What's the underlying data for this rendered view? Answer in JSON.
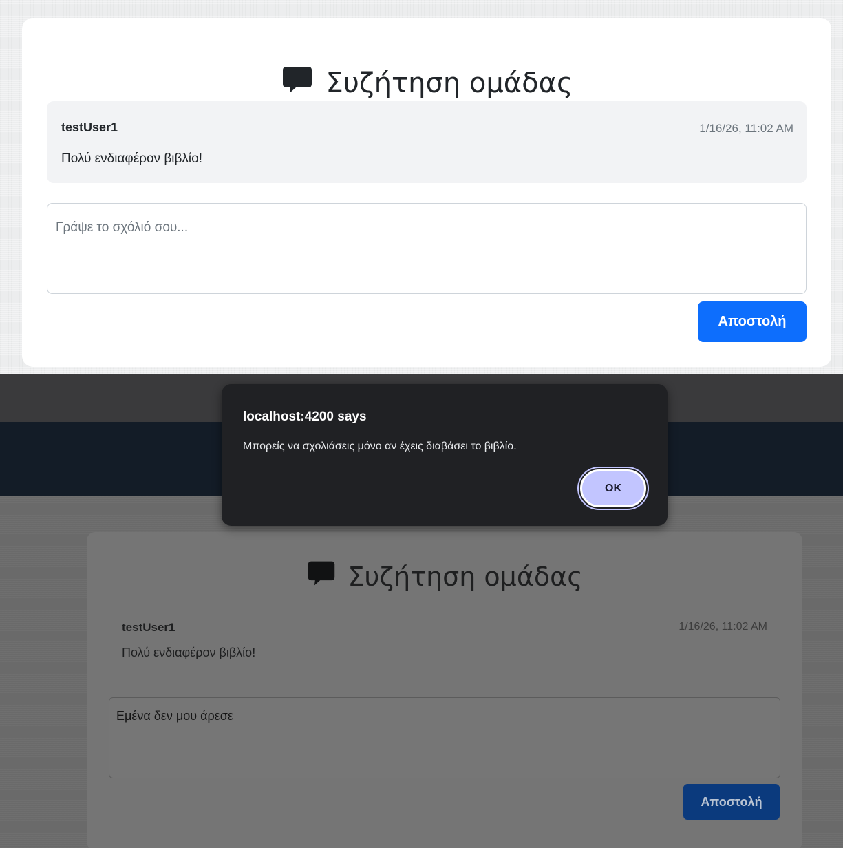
{
  "top_panel": {
    "title": "Συζήτηση ομάδας",
    "icon": "speech-bubble-icon",
    "comment": {
      "user": "testUser1",
      "time": "1/16/26, 11:02 AM",
      "text": "Πολύ ενδιαφέρον βιβλίο!"
    },
    "textarea": {
      "placeholder": "Γράψε το σχόλιό σου...",
      "value": ""
    },
    "submit_label": "Αποστολή",
    "colors": {
      "accent": "#0d6efd"
    }
  },
  "bottom_panel": {
    "title": "Συζήτηση ομάδας",
    "icon": "speech-bubble-icon",
    "comment": {
      "user": "testUser1",
      "time": "1/16/26, 11:02 AM",
      "text": "Πολύ ενδιαφέρον βιβλίο!"
    },
    "textarea": {
      "value": "Εμένα δεν μου άρεσε"
    },
    "submit_label": "Αποστολή",
    "alert": {
      "title": "localhost:4200 says",
      "message": "Μπορείς να σχολιάσεις μόνο αν έχεις διαβάσει το βιβλίο.",
      "ok_label": "OK"
    },
    "colors": {
      "navbar": "#131c27",
      "dialog": "#202124",
      "ok_button": "#c2c5ff"
    }
  }
}
